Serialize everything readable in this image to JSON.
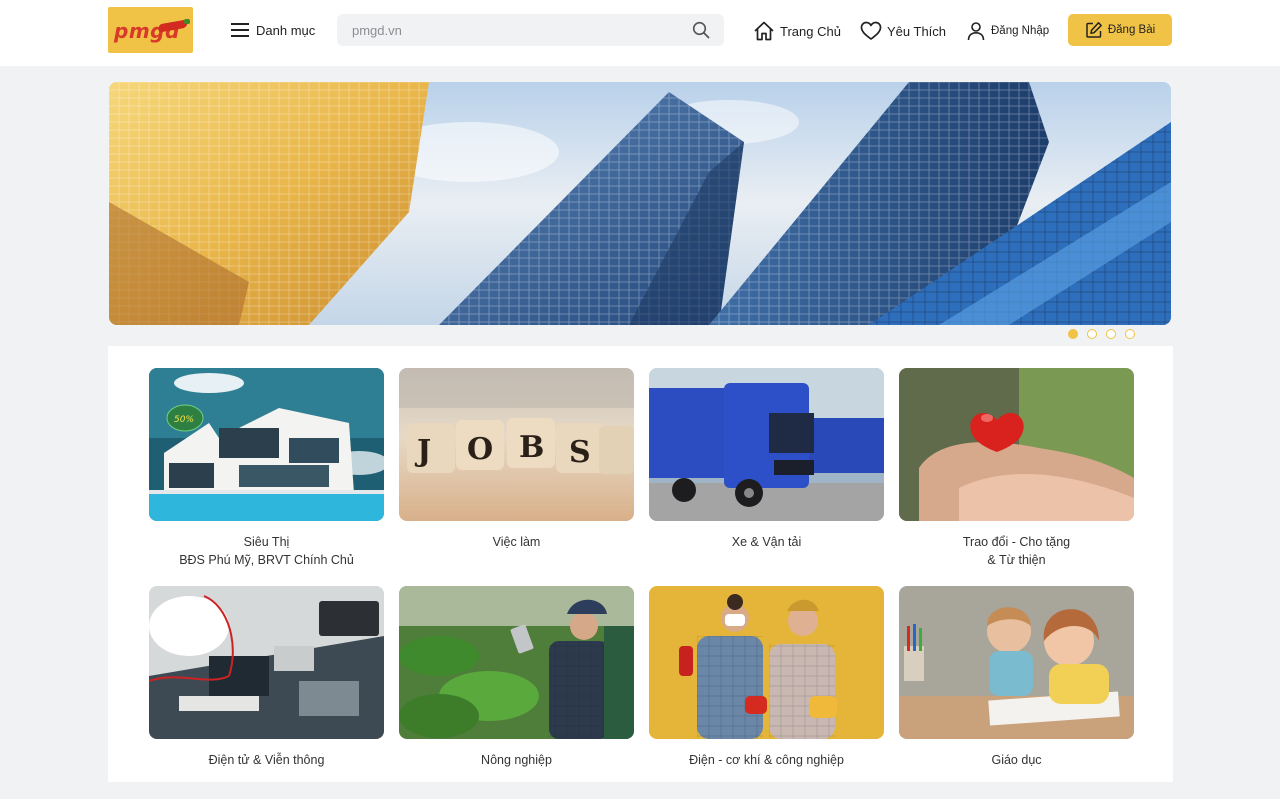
{
  "header": {
    "logo_text": "pmgd",
    "menu_label": "Danh mục",
    "menu_icon": "hamburger-icon",
    "search": {
      "placeholder": "pmgd.vn",
      "icon": "search-icon"
    },
    "nav": [
      {
        "label": "Trang Chủ",
        "icon": "home-icon"
      },
      {
        "label": "Yêu Thích",
        "icon": "heart-icon"
      },
      {
        "label": "Đăng Nhập",
        "icon": "user-icon"
      }
    ],
    "post_button": {
      "label": "Đăng Bài",
      "icon": "edit-icon"
    }
  },
  "banner": {
    "slides": 4,
    "active_slide": 1
  },
  "categories": [
    {
      "label_line1": "Siêu Thị",
      "label_line2": "BĐS Phú Mỹ, BRVT Chính Chủ",
      "image_text": "50%"
    },
    {
      "label_line1": "Việc làm",
      "label_line2": "",
      "image_text": "JOBS"
    },
    {
      "label_line1": "Xe & Vận tải",
      "label_line2": ""
    },
    {
      "label_line1": "Trao đổi - Cho tặng",
      "label_line2": "& Từ thiện"
    },
    {
      "label_line1": "Điện tử & Viễn  thông",
      "label_line2": ""
    },
    {
      "label_line1": "Nông nghiệp",
      "label_line2": ""
    },
    {
      "label_line1": "Điện - cơ khí & công nghiệp",
      "label_line2": ""
    },
    {
      "label_line1": "Giáo dục",
      "label_line2": ""
    }
  ],
  "colors": {
    "accent": "#f0c346",
    "logo_red": "#d83a2a",
    "page_bg": "#f1f2f4"
  }
}
